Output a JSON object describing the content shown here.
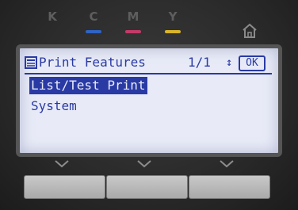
{
  "toner": [
    {
      "label": "K",
      "color": "#222222"
    },
    {
      "label": "C",
      "color": "#2f63c4"
    },
    {
      "label": "M",
      "color": "#c23a6a"
    },
    {
      "label": "Y",
      "color": "#d8b52a"
    }
  ],
  "screen": {
    "title": "Print Features",
    "page": "1/1",
    "updown_glyph": "↕",
    "ok_label": "OK",
    "items": [
      {
        "label": "List/Test Print",
        "selected": true
      },
      {
        "label": "System",
        "selected": false
      }
    ]
  },
  "icons": {
    "home": "home-icon",
    "document": "document-icon",
    "chevron": "chevron-down-icon"
  },
  "colors": {
    "lcd_background": "#e8ebf7",
    "lcd_text": "#2a3aa4"
  }
}
